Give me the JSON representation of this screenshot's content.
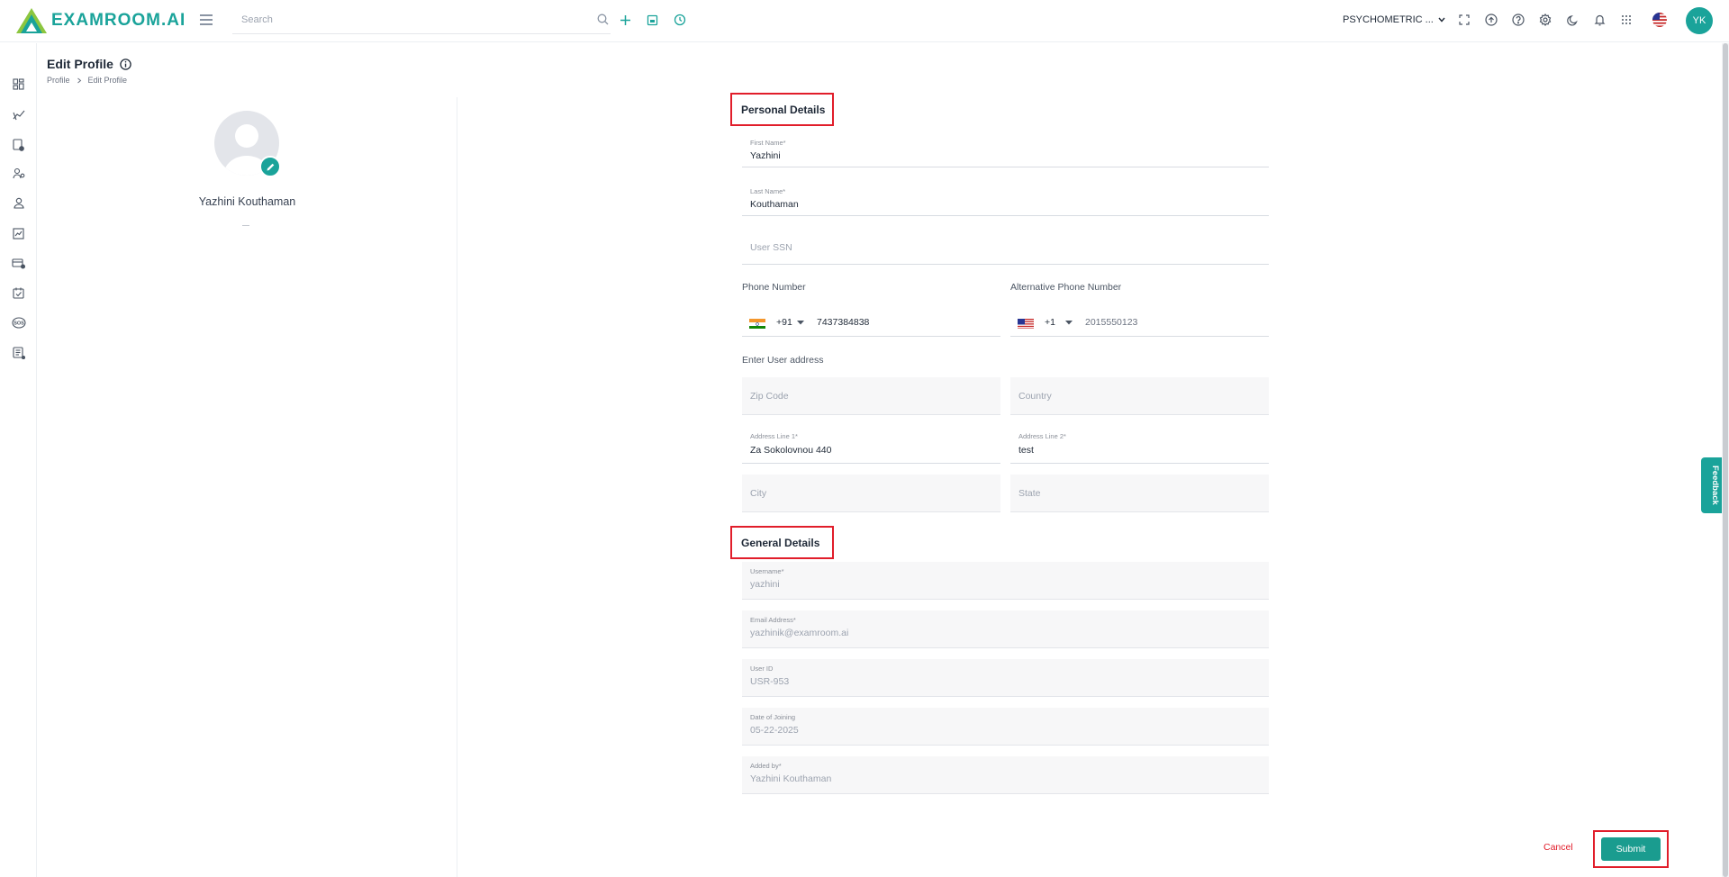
{
  "app": {
    "logo_text": "EXAMROOM.AI"
  },
  "header": {
    "search_placeholder": "Search",
    "org_selector": "PSYCHOMETRIC ...",
    "user_initials": "YK",
    "colors": {
      "brand": "#1aa39a"
    }
  },
  "page": {
    "title": "Edit Profile",
    "breadcrumb": [
      "Profile",
      "Edit Profile"
    ]
  },
  "profile": {
    "name": "Yazhini Kouthaman"
  },
  "personal": {
    "section_title": "Personal Details",
    "first_name_label": "First Name*",
    "first_name": "Yazhini",
    "last_name_label": "Last Name*",
    "last_name": "Kouthaman",
    "ssn_placeholder": "User SSN",
    "phone_label": "Phone Number",
    "phone_code": "+91",
    "phone_number": "7437384838",
    "alt_phone_label": "Alternative Phone Number",
    "alt_phone_code": "+1",
    "alt_phone_number": "2015550123",
    "address_label": "Enter User address",
    "zip_placeholder": "Zip Code",
    "country_placeholder": "Country",
    "address1_label": "Address Line 1*",
    "address1": "Za Sokolovnou 440",
    "address2_label": "Address Line 2*",
    "address2": "test",
    "city_placeholder": "City",
    "state_placeholder": "State"
  },
  "general": {
    "section_title": "General Details",
    "username_label": "Username*",
    "username": "yazhini",
    "email_label": "Email Address*",
    "email": "yazhinik@examroom.ai",
    "user_id_label": "User ID",
    "user_id": "USR-953",
    "doj_label": "Date of Joining",
    "doj": "05-22-2025",
    "added_by_label": "Added by*",
    "added_by": "Yazhini Kouthaman"
  },
  "actions": {
    "cancel": "Cancel",
    "submit": "Submit"
  },
  "feedback_tab": "Feedback"
}
